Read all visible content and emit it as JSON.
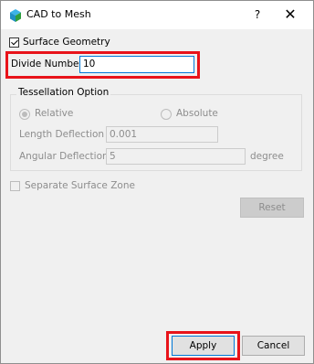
{
  "window": {
    "title": "CAD to Mesh",
    "help_label": "?",
    "close_label": "✕"
  },
  "surface_geometry": {
    "label": "Surface Geometry",
    "checked": true
  },
  "divide_number": {
    "label": "Divide Number",
    "value": "10"
  },
  "tessellation": {
    "group_title": "Tessellation Option",
    "relative_label": "Relative",
    "absolute_label": "Absolute",
    "selected": "Relative",
    "length_deflection_label": "Length Deflection",
    "length_deflection_value": "0.001",
    "angular_deflection_label": "Angular Deflection",
    "angular_deflection_value": "5",
    "angular_unit": "degree"
  },
  "separate_surface_zone": {
    "label": "Separate Surface Zone",
    "checked": false
  },
  "buttons": {
    "reset_label": "Reset",
    "apply_label": "Apply",
    "cancel_label": "Cancel"
  },
  "colors": {
    "highlight": "#e8131a",
    "focus_border": "#0078d7",
    "dialog_bg": "#f0f0f0"
  }
}
